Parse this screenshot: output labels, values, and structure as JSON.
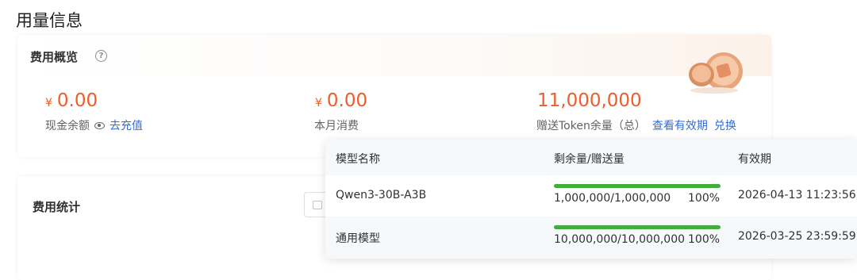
{
  "page_title": "用量信息",
  "overview": {
    "title": "费用概览",
    "help_glyph": "?",
    "cash_balance": {
      "currency": "¥",
      "amount": "0.00",
      "label": "现金余额",
      "recharge_link": "去充值"
    },
    "monthly_spend": {
      "currency": "¥",
      "amount": "0.00",
      "label": "本月消费"
    },
    "gift_tokens": {
      "amount": "11,000,000",
      "label": "赠送Token余量（总）",
      "validity_link": "查看有效期",
      "redeem_link": "兑换"
    }
  },
  "stats": {
    "title": "费用统计"
  },
  "validity_popover": {
    "headers": [
      "模型名称",
      "剩余量/赠送量",
      "有效期"
    ],
    "rows": [
      {
        "model": "Qwen3-30B-A3B",
        "remaining": "1,000,000/1,000,000",
        "percent_label": "100%",
        "percent": 100,
        "expires": "2026-04-13 11:23:56"
      },
      {
        "model": "通用模型",
        "remaining": "10,000,000/10,000,000",
        "percent_label": "100%",
        "percent": 100,
        "expires": "2026-03-25 23:59:59"
      }
    ]
  },
  "colors": {
    "accent_amount": "#ef5b2a",
    "link": "#2f6ce0",
    "progress": "#3fae3c"
  }
}
